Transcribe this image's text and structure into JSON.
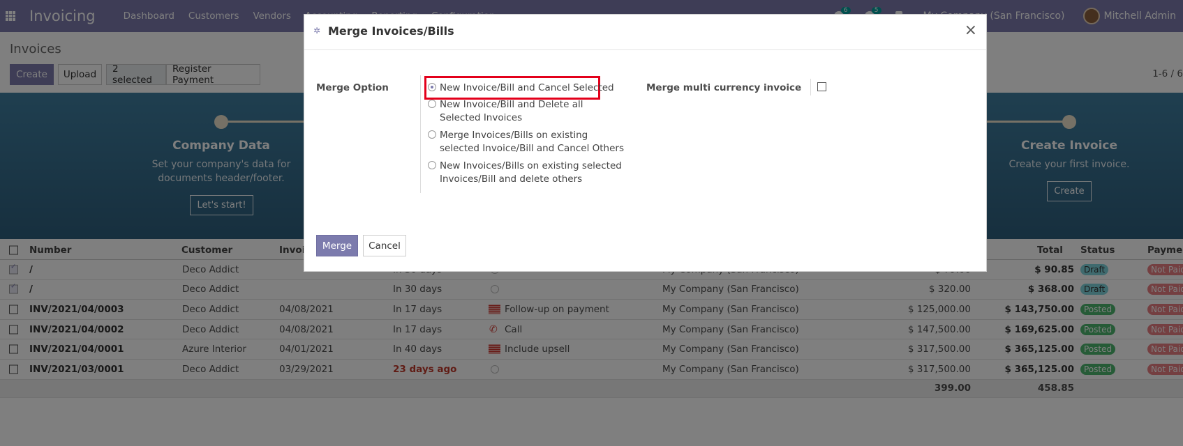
{
  "topnav": {
    "app_title": "Invoicing",
    "menu": [
      "Dashboard",
      "Customers",
      "Vendors",
      "Accounting",
      "Reporting",
      "Configuration"
    ],
    "chat_badge": "6",
    "activity_badge": "5",
    "company": "My Company (San Francisco)",
    "username": "Mitchell Admin"
  },
  "control": {
    "breadcrumb": "Invoices",
    "create_label": "Create",
    "upload_label": "Upload",
    "selected_label": "2 selected",
    "register_payment_label": "Register Payment",
    "pager": "1-6 / 6"
  },
  "banner": {
    "steps": [
      {
        "title": "Company Data",
        "desc1": "Set your company's data for",
        "desc2": "documents header/footer.",
        "button": "Let's start!"
      },
      {
        "title": "Create Invoice",
        "desc1": "Create your first invoice.",
        "desc2": "",
        "button": "Create"
      }
    ]
  },
  "table": {
    "headers": {
      "number": "Number",
      "customer": "Customer",
      "invoice_date": "Invoice Date",
      "total": "Total",
      "status": "Status",
      "payment": "Payment Status"
    },
    "rows": [
      {
        "number": "/",
        "customer": "Deco Addict",
        "date": "",
        "due": "In 30 days",
        "activity": "",
        "company": "My Company (San Francisco)",
        "untaxed": "$ 79.00",
        "total": "$ 90.85",
        "status": "Draft",
        "payment": "Not Paid"
      },
      {
        "number": "/",
        "customer": "Deco Addict",
        "date": "",
        "due": "In 30 days",
        "activity": "",
        "company": "My Company (San Francisco)",
        "untaxed": "$ 320.00",
        "total": "$ 368.00",
        "status": "Draft",
        "payment": "Not Paid"
      },
      {
        "number": "INV/2021/04/0003",
        "customer": "Deco Addict",
        "date": "04/08/2021",
        "due": "In 17 days",
        "activity": "Follow-up on payment",
        "company": "My Company (San Francisco)",
        "untaxed": "$ 125,000.00",
        "total": "$ 143,750.00",
        "status": "Posted",
        "payment": "Not Paid"
      },
      {
        "number": "INV/2021/04/0002",
        "customer": "Deco Addict",
        "date": "04/08/2021",
        "due": "In 17 days",
        "activity": "Call",
        "company": "My Company (San Francisco)",
        "untaxed": "$ 147,500.00",
        "total": "$ 169,625.00",
        "status": "Posted",
        "payment": "Not Paid"
      },
      {
        "number": "INV/2021/04/0001",
        "customer": "Azure Interior",
        "date": "04/01/2021",
        "due": "In 40 days",
        "activity": "Include upsell",
        "company": "My Company (San Francisco)",
        "untaxed": "$ 317,500.00",
        "total": "$ 365,125.00",
        "status": "Posted",
        "payment": "Not Paid"
      },
      {
        "number": "INV/2021/03/0001",
        "customer": "Deco Addict",
        "date": "03/29/2021",
        "due": "23 days ago",
        "activity": "",
        "company": "My Company (San Francisco)",
        "untaxed": "$ 317,500.00",
        "total": "$ 365,125.00",
        "status": "Posted",
        "payment": "Not Paid"
      }
    ],
    "footer": {
      "untaxed_sum": "399.00",
      "total_sum": "458.85"
    }
  },
  "modal": {
    "title": "Merge Invoices/Bills",
    "merge_option_label": "Merge Option",
    "options": [
      {
        "line1": "New Invoice/Bill and Cancel Selected",
        "line2": ""
      },
      {
        "line1": "New Invoice/Bill and Delete all",
        "line2": "Selected Invoices"
      },
      {
        "line1": "Merge Invoices/Bills on existing",
        "line2": "selected Invoice/Bill and Cancel Others"
      },
      {
        "line1": "New Invoices/Bills on existing selected",
        "line2": "Invoices/Bill and delete others"
      }
    ],
    "selected_option_index": 0,
    "multi_currency_label": "Merge multi currency invoice",
    "multi_currency_checked": false,
    "merge_button": "Merge",
    "cancel_button": "Cancel"
  },
  "colors": {
    "primary": "#7c7bad",
    "highlight": "#e3001b",
    "banner": "#3f7ea0"
  }
}
